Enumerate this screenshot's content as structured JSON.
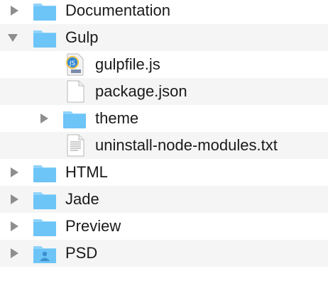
{
  "rows": [
    {
      "label": "Documentation",
      "kind": "folder",
      "disclosure": "collapsed",
      "depth": 0
    },
    {
      "label": "Gulp",
      "kind": "folder",
      "disclosure": "expanded",
      "depth": 0
    },
    {
      "label": "gulpfile.js",
      "kind": "js-file",
      "disclosure": "none",
      "depth": 1
    },
    {
      "label": "package.json",
      "kind": "blank-file",
      "disclosure": "none",
      "depth": 1
    },
    {
      "label": "theme",
      "kind": "folder",
      "disclosure": "collapsed",
      "depth": 1
    },
    {
      "label": "uninstall-node-modules.txt",
      "kind": "text-file",
      "disclosure": "none",
      "depth": 1
    },
    {
      "label": "HTML",
      "kind": "folder",
      "disclosure": "collapsed",
      "depth": 0
    },
    {
      "label": "Jade",
      "kind": "folder",
      "disclosure": "collapsed",
      "depth": 0
    },
    {
      "label": "Preview",
      "kind": "folder",
      "disclosure": "collapsed",
      "depth": 0
    },
    {
      "label": "PSD",
      "kind": "user-folder",
      "disclosure": "collapsed",
      "depth": 0
    }
  ],
  "colors": {
    "folder_body": "#6cc4f7",
    "folder_tab": "#8fd3fb",
    "disclosure": "#8e8e8e",
    "row_alt": "#f5f5f5"
  }
}
